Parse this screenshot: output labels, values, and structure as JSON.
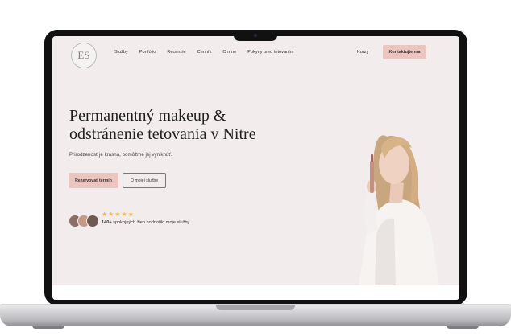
{
  "logo": {
    "text": "ES"
  },
  "nav": {
    "items": [
      "Služby",
      "Portfólio",
      "Recenzie",
      "Cenník",
      "O mne",
      "Pokyny pred tetovaním"
    ],
    "kurzy": "Kurzy",
    "contact": "Kontaktujte ma"
  },
  "hero": {
    "title_line1": "Permanentný makeup &",
    "title_line2": "odstránenie tetovania v Nitre",
    "subtitle": "Prirodzenosť je krásna, pomôžme jej vyniknúť.",
    "primary_button": "Rezervovať termín",
    "secondary_button": "O mojej službe",
    "stars": "★★★★★",
    "reviews_bold": "140+",
    "reviews_text": " spokojných žien hodnotilo moje služby"
  },
  "colors": {
    "accent": "#ebc6c0",
    "background": "#f3ecec",
    "stars": "#f2c037"
  },
  "icons": [
    "star-icon",
    "laptop-frame"
  ]
}
